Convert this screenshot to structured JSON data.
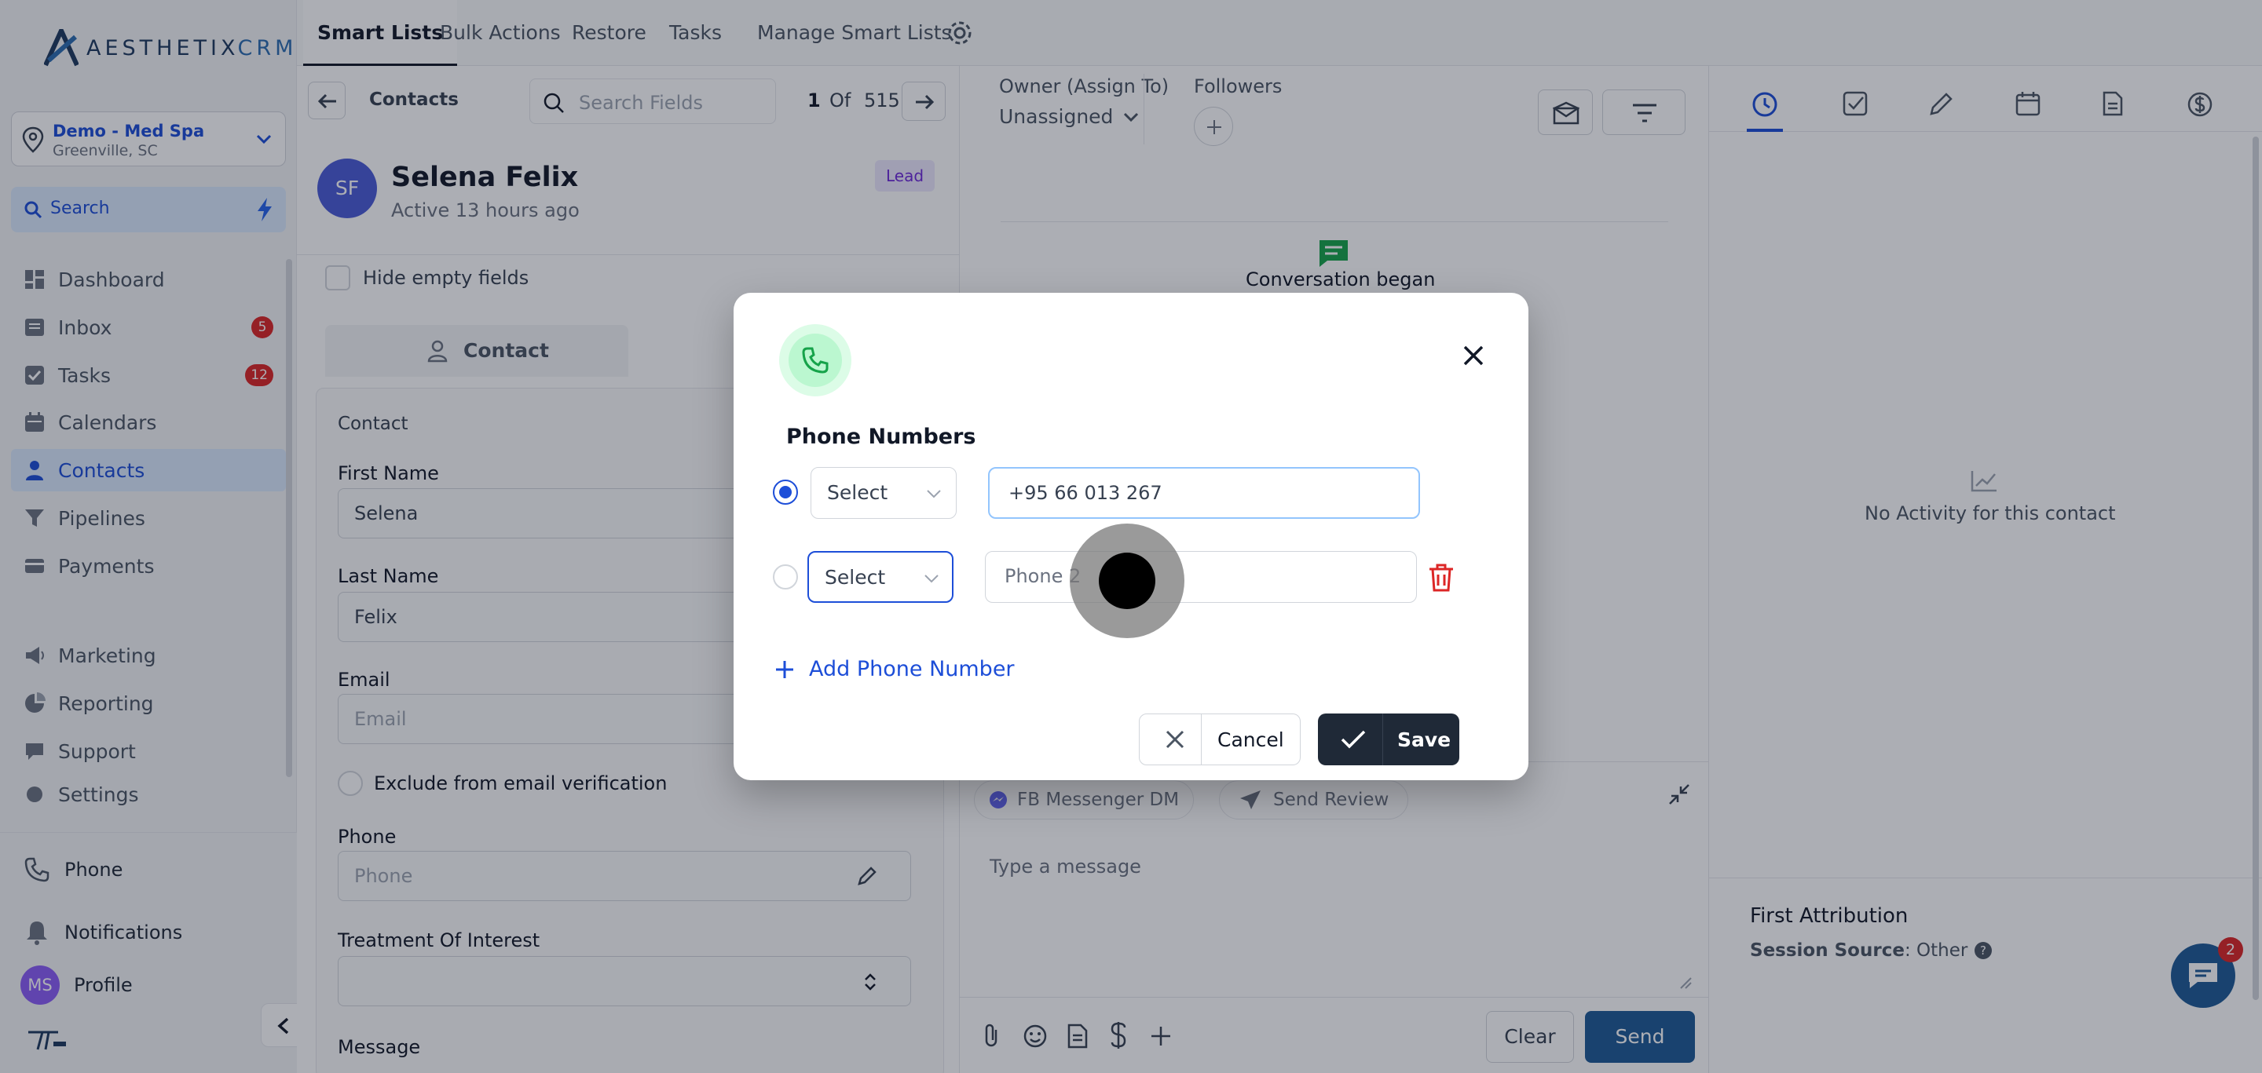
{
  "app": {
    "logo_text": "AESTHETIX",
    "logo_accent": "CRM",
    "location_name": "Demo - Med Spa",
    "location_sub": "Greenville, SC",
    "search_label": "Search"
  },
  "sidebar": {
    "items": [
      {
        "label": "Dashboard",
        "icon": "dashboard-icon"
      },
      {
        "label": "Inbox",
        "icon": "inbox-icon",
        "badge": "5"
      },
      {
        "label": "Tasks",
        "icon": "tasks-icon",
        "badge": "12"
      },
      {
        "label": "Calendars",
        "icon": "calendar-icon"
      },
      {
        "label": "Contacts",
        "icon": "contacts-icon",
        "active": true
      },
      {
        "label": "Pipelines",
        "icon": "pipelines-icon"
      },
      {
        "label": "Payments",
        "icon": "payments-icon"
      },
      {
        "label": "Marketing",
        "icon": "marketing-icon"
      },
      {
        "label": "Reporting",
        "icon": "reporting-icon"
      },
      {
        "label": "Support",
        "icon": "support-icon"
      },
      {
        "label": "Settings",
        "icon": "settings-icon"
      }
    ],
    "phone_label": "Phone",
    "notifications_label": "Notifications",
    "profile_label": "Profile",
    "profile_initials": "MS"
  },
  "topbar": {
    "tabs": [
      "Smart Lists",
      "Bulk Actions",
      "Restore",
      "Tasks",
      "Manage Smart Lists"
    ]
  },
  "contact": {
    "breadcrumb": "Contacts",
    "search_fields_placeholder": "Search Fields",
    "pager_current": "1",
    "pager_of": "Of",
    "pager_total": "515",
    "initials": "SF",
    "name": "Selena Felix",
    "active_text": "Active 13 hours ago",
    "status_badge": "Lead",
    "hide_empty_label": "Hide empty fields",
    "tab_contact": "Contact",
    "section_title": "Contact",
    "first_name_label": "First Name",
    "first_name_value": "Selena",
    "last_name_label": "Last Name",
    "last_name_value": "Felix",
    "email_label": "Email",
    "email_placeholder": "Email",
    "exclude_email_label": "Exclude from email verification",
    "phone_label": "Phone",
    "phone_placeholder": "Phone",
    "treatment_label": "Treatment Of Interest",
    "message_label": "Message"
  },
  "conversation": {
    "owner_label": "Owner (Assign To)",
    "owner_value": "Unassigned",
    "followers_label": "Followers",
    "conversation_began": "Conversation began",
    "channel_fb": "FB Messenger DM",
    "channel_review": "Send Review",
    "message_placeholder": "Type a message",
    "clear_label": "Clear",
    "send_label": "Send"
  },
  "activity": {
    "empty_text": "No Activity for this contact",
    "first_attribution": "First Attribution",
    "session_source_label": "Session Source",
    "session_source_value": ": Other",
    "chat_badge": "2"
  },
  "modal": {
    "title": "Phone Numbers",
    "row1_select": "Select",
    "row1_phone": "+95 66 013 267",
    "row2_select": "Select",
    "row2_placeholder": "Phone 2",
    "add_label": "Add Phone Number",
    "cancel_label": "Cancel",
    "save_label": "Save"
  },
  "colors": {
    "accent": "#1d4ed8",
    "dark": "#1f2937",
    "danger": "#dc2626",
    "send": "#1e5a96"
  }
}
